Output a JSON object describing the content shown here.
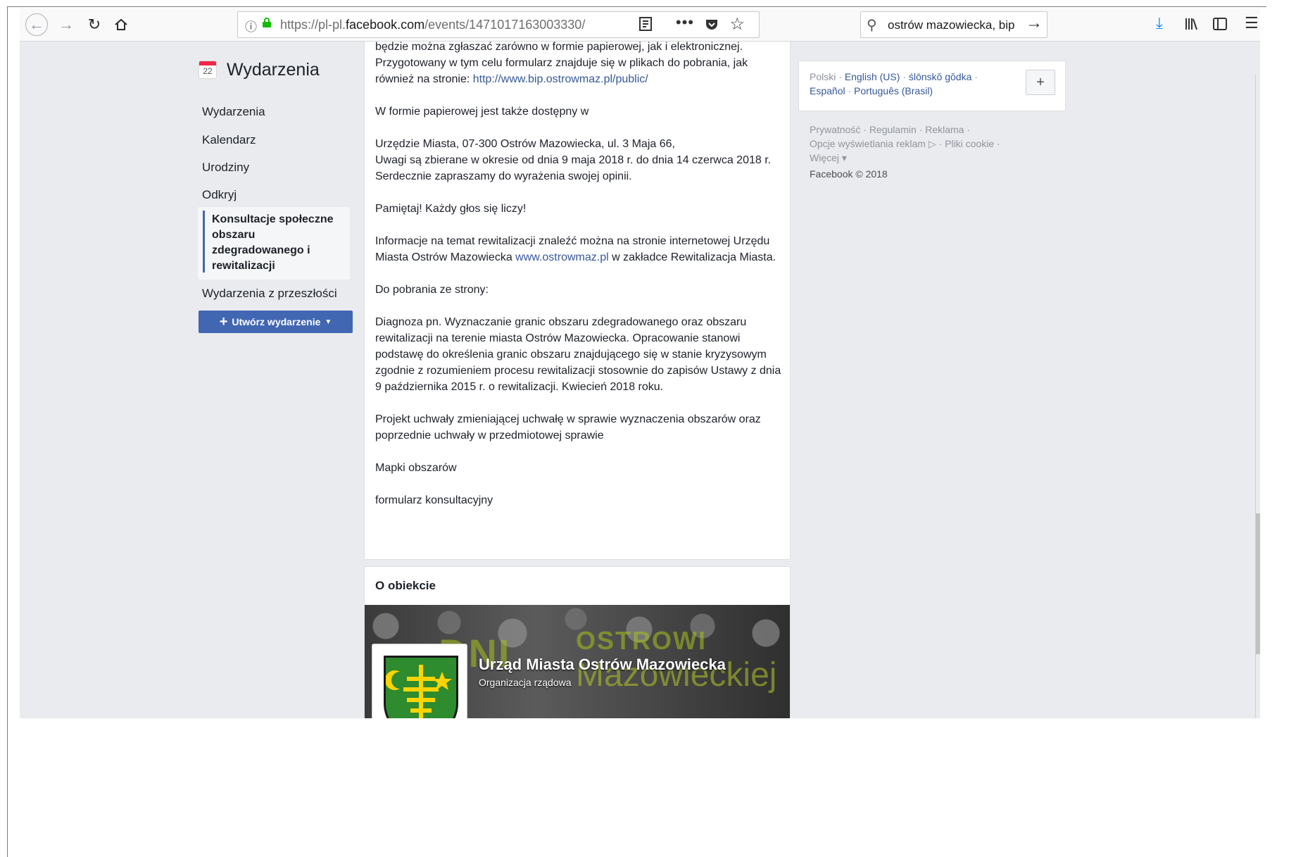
{
  "browser": {
    "url_prefix": "https://pl-pl.",
    "url_domain": "facebook.com",
    "url_path": "/events/1471017163003330/",
    "search_text": "ostrów mazowiecka, bip"
  },
  "nav": {
    "calendar_day": "22",
    "title": "Wydarzenia",
    "items": [
      "Wydarzenia",
      "Kalendarz",
      "Urodziny",
      "Odkryj"
    ],
    "active_item": "Konsultacje społeczne obszaru zdegradowanego i rewitalizacji",
    "past_item": "Wydarzenia z przeszłości",
    "create_label": "Utwórz wydarzenie"
  },
  "content": {
    "line_cut": "będzie można zgłaszać zarówno w formie papierowej, jak i elektronicznej.",
    "p1_text": "Przygotowany w tym celu formularz znajduje się w plikach do pobrania, jak również na stronie: ",
    "p1_link": "http://www.bip.ostrowmaz.pl/public/",
    "p2": "W formie papierowej jest także dostępny w",
    "p3_a": "Urzędzie Miasta, 07-300 Ostrów Mazowiecka, ul. 3 Maja 66,",
    "p3_b": "Uwagi są zbierane w okresie od dnia 9 maja 2018 r. do dnia 14 czerwca 2018 r.",
    "p3_c": "Serdecznie zapraszamy do wyrażenia swojej opinii.",
    "p4": "Pamiętaj! Każdy głos się liczy!",
    "p5_text": "Informacje na temat rewitalizacji znaleźć można na stronie internetowej Urzędu Miasta Ostrów Mazowiecka ",
    "p5_link": "www.ostrowmaz.pl",
    "p5_tail": " w zakładce Rewitalizacja Miasta.",
    "p6": "Do pobrania ze strony:",
    "p7": "Diagnoza pn. Wyznaczanie granic obszaru zdegradowanego oraz obszaru rewitalizacji na terenie miasta Ostrów Mazowiecka. Opracowanie stanowi podstawę do określenia granic obszaru znajdującego się w stanie kryzysowym zgodnie z rozumieniem procesu rewitalizacji stosownie do zapisów Ustawy z dnia 9 października 2015 r. o rewitalizacji. Kwiecień 2018 roku.",
    "p8": "Projekt uchwały zmieniającej uchwałę w sprawie wyznaczenia obszarów oraz poprzednie uchwały w przedmiotowej sprawie",
    "p9": "Mapki obszarów",
    "p10": "formularz konsultacyjny"
  },
  "about": {
    "title": "O obiekcie",
    "cover_text_1": "DNI",
    "cover_text_2": "OSTROWI",
    "cover_text_3": "Mazowieckiej",
    "org_name": "Urząd Miasta Ostrów Mazowiecka",
    "org_type": "Organizacja rządowa"
  },
  "sidebar_right": {
    "lang_current": "Polski",
    "lang_links": [
      "English (US)",
      "ślōnskŏ gŏdka",
      "Español",
      "Português (Brasil)"
    ],
    "footer_links": [
      "Prywatność",
      "Regulamin",
      "Reklama",
      "Opcje wyświetlania reklam",
      "Pliki cookie",
      "Więcej"
    ],
    "copyright": "Facebook © 2018"
  }
}
